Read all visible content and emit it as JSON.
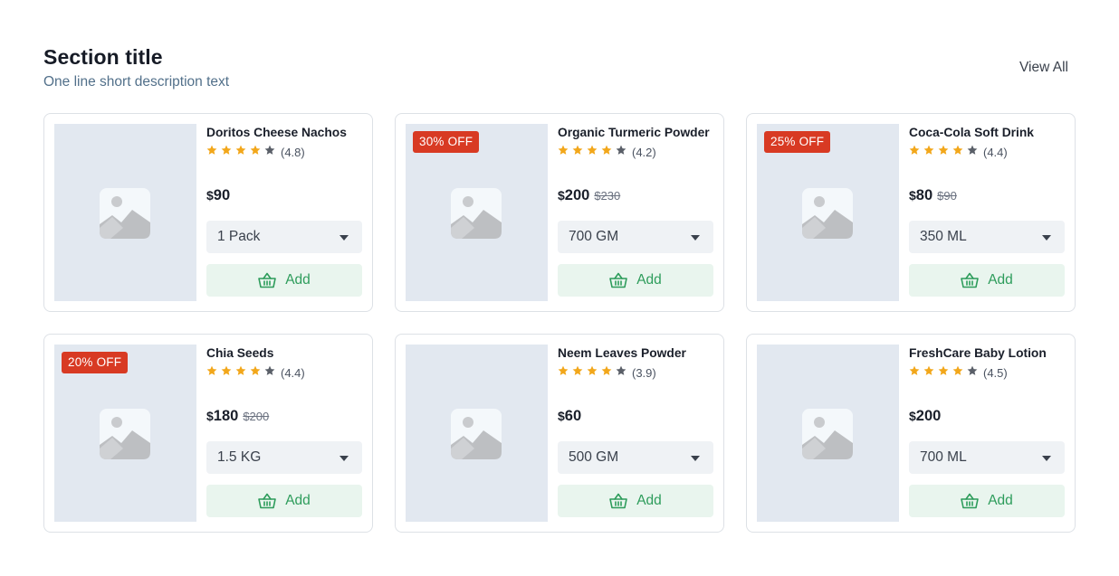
{
  "section": {
    "title": "Section title",
    "description": "One line short description text",
    "view_all": "View All"
  },
  "colors": {
    "badge": "#d83a23",
    "star_filled": "#f2a71b",
    "star_empty": "#5a5f68",
    "add_bg": "#e9f5ee",
    "add_text": "#2d9c5b",
    "thumb_bg": "#e2e8f0"
  },
  "icons": {
    "image_placeholder": "image-placeholder-icon",
    "basket": "basket-icon",
    "star": "star-icon",
    "caret": "chevron-down-icon"
  },
  "products": [
    {
      "name": "Doritos Cheese Nachos",
      "rating": 4.8,
      "rating_text": "(4.8)",
      "filled_stars": 4,
      "currency": "$",
      "price": "90",
      "old_price": "",
      "badge": "",
      "variant": "1 Pack",
      "add_label": "Add"
    },
    {
      "name": "Organic Turmeric Powder",
      "rating": 4.2,
      "rating_text": "(4.2)",
      "filled_stars": 4,
      "currency": "$",
      "price": "200",
      "old_price": "$230",
      "badge": "30% OFF",
      "variant": "700 GM",
      "add_label": "Add"
    },
    {
      "name": "Coca-Cola Soft Drink",
      "rating": 4.4,
      "rating_text": "(4.4)",
      "filled_stars": 4,
      "currency": "$",
      "price": "80",
      "old_price": "$90",
      "badge": "25% OFF",
      "variant": "350 ML",
      "add_label": "Add"
    },
    {
      "name": "Chia Seeds",
      "rating": 4.4,
      "rating_text": "(4.4)",
      "filled_stars": 4,
      "currency": "$",
      "price": "180",
      "old_price": "$200",
      "badge": "20% OFF",
      "variant": "1.5 KG",
      "add_label": "Add"
    },
    {
      "name": "Neem Leaves Powder",
      "rating": 3.9,
      "rating_text": "(3.9)",
      "filled_stars": 4,
      "currency": "$",
      "price": "60",
      "old_price": "",
      "badge": "",
      "variant": "500 GM",
      "add_label": "Add"
    },
    {
      "name": "FreshCare Baby Lotion",
      "rating": 4.5,
      "rating_text": "(4.5)",
      "filled_stars": 4,
      "currency": "$",
      "price": "200",
      "old_price": "",
      "badge": "",
      "variant": "700 ML",
      "add_label": "Add"
    }
  ]
}
